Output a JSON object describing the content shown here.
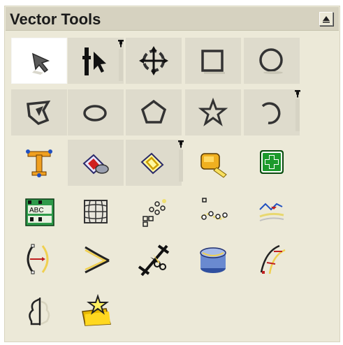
{
  "panel": {
    "title": "Vector Tools",
    "collapse_button": "collapse-up-icon"
  },
  "tools": [
    {
      "name": "pointer-tool",
      "icon": "arrow-pointer-icon",
      "selected": true
    },
    {
      "name": "subselect-tool",
      "icon": "subselect-pointer-icon"
    },
    {
      "name": "transform-tool",
      "icon": "free-transform-icon"
    },
    {
      "name": "rectangle-tool",
      "icon": "rectangle-icon"
    },
    {
      "name": "ellipse-tool",
      "icon": "circle-icon"
    },
    {
      "name": "freeform-shape-tool",
      "icon": "freeform-shape-icon"
    },
    {
      "name": "oval-tool",
      "icon": "oval-icon"
    },
    {
      "name": "polygon-tool",
      "icon": "pentagon-icon"
    },
    {
      "name": "star-tool",
      "icon": "star-icon"
    },
    {
      "name": "arc-tool",
      "icon": "arc-icon"
    },
    {
      "name": "text-tool",
      "icon": "text-t-icon"
    },
    {
      "name": "fill-tool",
      "icon": "paint-bucket-icon"
    },
    {
      "name": "lasso-tool",
      "icon": "lasso-icon"
    },
    {
      "name": "measure-tool",
      "icon": "tape-measure-icon"
    },
    {
      "name": "add-tool",
      "icon": "green-plus-icon"
    },
    {
      "name": "text-table-tool",
      "icon": "abc-grid-icon"
    },
    {
      "name": "envelope-tool",
      "icon": "envelope-warp-icon"
    },
    {
      "name": "scatter-tool",
      "icon": "scatter-points-icon"
    },
    {
      "name": "path-nodes-tool",
      "icon": "path-nodes-icon"
    },
    {
      "name": "blend-tool",
      "icon": "blend-lines-icon"
    },
    {
      "name": "bend-tool",
      "icon": "bend-curve-icon"
    },
    {
      "name": "angle-tool",
      "icon": "angle-curve-icon"
    },
    {
      "name": "knife-tool",
      "icon": "scissors-icon"
    },
    {
      "name": "extrude-tool",
      "icon": "extrude-cylinder-icon"
    },
    {
      "name": "roughen-tool",
      "icon": "roughen-curve-icon"
    },
    {
      "name": "trace-tool",
      "icon": "trace-outline-icon"
    },
    {
      "name": "symbol-tool",
      "icon": "star-folder-icon"
    }
  ],
  "flyout_marker": "flyout-pin-icon"
}
